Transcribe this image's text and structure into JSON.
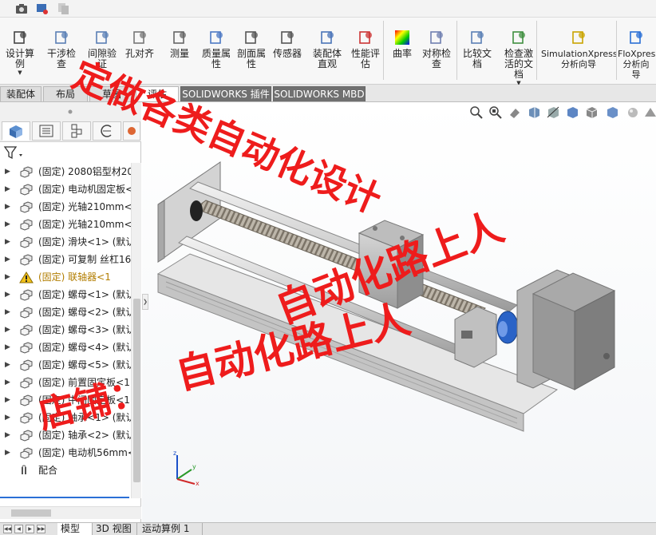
{
  "ribbon": {
    "buttons": [
      {
        "label": "设计算\n例",
        "icon": "design-study-icon",
        "caret": true
      },
      {
        "label": "干涉检\n查",
        "icon": "interference-icon"
      },
      {
        "label": "间隙验\n证",
        "icon": "clearance-icon"
      },
      {
        "label": "孔对齐",
        "icon": "hole-align-icon"
      },
      {
        "label": "测量",
        "icon": "measure-icon"
      },
      {
        "label": "质量属\n性",
        "icon": "mass-properties-icon"
      },
      {
        "label": "剖面属\n性",
        "icon": "section-properties-icon"
      },
      {
        "label": "传感器",
        "icon": "sensor-icon"
      },
      {
        "label": "装配体\n直观",
        "icon": "assembly-visualization-icon"
      },
      {
        "label": "性能评\n估",
        "icon": "performance-icon"
      },
      {
        "label": "曲率",
        "icon": "curvature-icon"
      },
      {
        "label": "对称检\n查",
        "icon": "symmetry-icon"
      },
      {
        "label": "比较文\n档",
        "icon": "compare-icon"
      },
      {
        "label": "检查激\n活的文\n档",
        "icon": "check-active-icon",
        "caret": true
      },
      {
        "label": "SimulationXpress\n分析向导",
        "icon": "simulation-icon"
      },
      {
        "label": "FloXpress\n分析向\n导",
        "icon": "floxpress-icon"
      }
    ]
  },
  "tabs": [
    "装配体",
    "布局",
    "草图",
    "评估",
    "SOLIDWORKS 插件",
    "SOLIDWORKS MBD"
  ],
  "active_tab": "评估",
  "tree": {
    "items": [
      {
        "text": "(固定) 2080铝型材20",
        "icon": "part-icon"
      },
      {
        "text": "(固定) 电动机固定板<",
        "icon": "part-icon"
      },
      {
        "text": "(固定) 光轴210mm<1",
        "icon": "part-icon"
      },
      {
        "text": "(固定) 光轴210mm<2",
        "icon": "part-icon"
      },
      {
        "text": "(固定) 滑块<1> (默认",
        "icon": "part-icon"
      },
      {
        "text": "(固定) 可复制 丝杠16",
        "icon": "part-icon"
      },
      {
        "text": "(固定) 联轴器<1",
        "icon": "warning-icon",
        "warn": true
      },
      {
        "text": "(固定) 螺母<1> (默认",
        "icon": "part-icon"
      },
      {
        "text": "(固定) 螺母<2> (默认",
        "icon": "part-icon"
      },
      {
        "text": "(固定) 螺母<3> (默认",
        "icon": "part-icon"
      },
      {
        "text": "(固定) 螺母<4> (默认",
        "icon": "part-icon"
      },
      {
        "text": "(固定) 螺母<5> (默认",
        "icon": "part-icon"
      },
      {
        "text": "(固定) 前置固定板<1",
        "icon": "part-icon"
      },
      {
        "text": "(固定) 中间固定板<1",
        "icon": "part-icon"
      },
      {
        "text": "(固定) 轴承<1> (默认",
        "icon": "part-icon"
      },
      {
        "text": "(固定) 轴承<2> (默认",
        "icon": "part-icon"
      },
      {
        "text": "(固定) 电动机56mm<",
        "icon": "part-icon"
      }
    ],
    "mates_label": "配合"
  },
  "bottom_tabs": [
    "模型",
    "3D 视图",
    "运动算例 1"
  ],
  "watermark": {
    "line1": "定做各类自动化设计",
    "line2": "自动化路上人",
    "line3": "自动化路上人",
    "line4": "店铺：",
    "color": "#ee1c1c"
  },
  "triad": {
    "x": "x",
    "y": "y",
    "z": "z"
  }
}
